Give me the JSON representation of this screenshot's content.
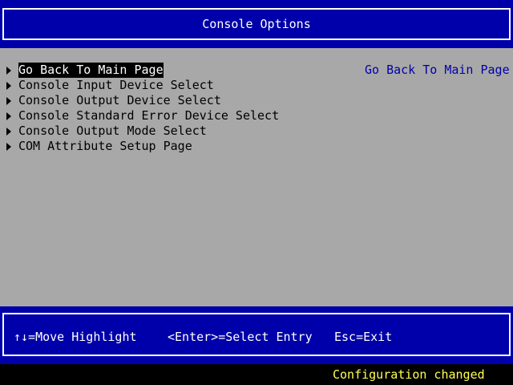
{
  "header": {
    "title": "Console Options"
  },
  "menu": {
    "items": [
      {
        "label": "Go Back To Main Page",
        "selected": true
      },
      {
        "label": "Console Input Device Select",
        "selected": false
      },
      {
        "label": "Console Output Device Select",
        "selected": false
      },
      {
        "label": "Console Standard Error Device Select",
        "selected": false
      },
      {
        "label": "Console Output Mode Select",
        "selected": false
      },
      {
        "label": "COM Attribute Setup Page",
        "selected": false
      }
    ],
    "help_text": "Go Back To Main Page"
  },
  "footer": {
    "move_hint": "↑↓=Move Highlight",
    "select_hint": "<Enter>=Select Entry",
    "exit_hint": "Esc=Exit"
  },
  "status": {
    "message": "Configuration changed"
  },
  "colors": {
    "header_background": "#0000aa",
    "main_background": "#a8a8a8",
    "highlight_background": "#000000",
    "help_text": "#0000aa",
    "status_text": "#ffff55"
  }
}
